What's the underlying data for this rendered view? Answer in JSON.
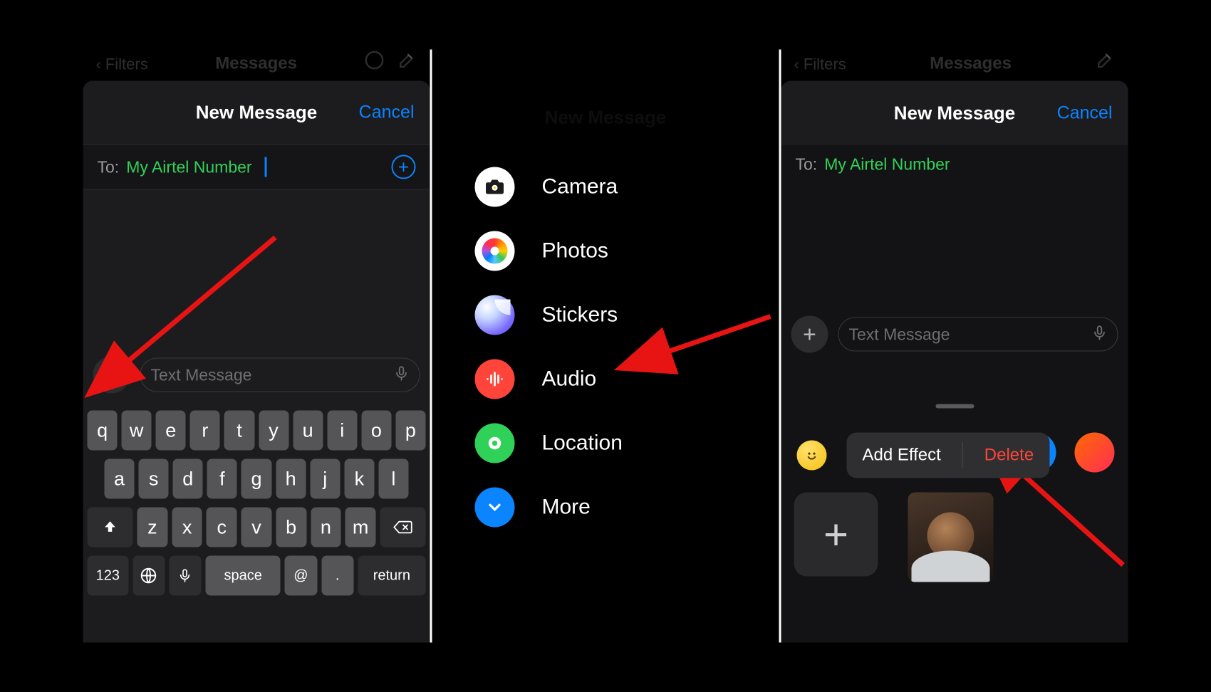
{
  "bg": {
    "filters": "Filters",
    "title": "Messages"
  },
  "modal": {
    "title": "New Message",
    "cancel": "Cancel"
  },
  "to": {
    "label": "To:",
    "recipient": "My Airtel Number"
  },
  "compose": {
    "placeholder": "Text Message"
  },
  "keyboard": {
    "row1": [
      "q",
      "w",
      "e",
      "r",
      "t",
      "y",
      "u",
      "i",
      "o",
      "p"
    ],
    "row2": [
      "a",
      "s",
      "d",
      "f",
      "g",
      "h",
      "j",
      "k",
      "l"
    ],
    "row3": [
      "z",
      "x",
      "c",
      "v",
      "b",
      "n",
      "m"
    ],
    "bottom": {
      "num": "123",
      "space": "space",
      "at": "@",
      "dot": ".",
      "return": "return"
    }
  },
  "menu": {
    "camera": "Camera",
    "photos": "Photos",
    "stickers": "Stickers",
    "audio": "Audio",
    "location": "Location",
    "more": "More"
  },
  "context": {
    "add_effect": "Add Effect",
    "delete": "Delete"
  }
}
